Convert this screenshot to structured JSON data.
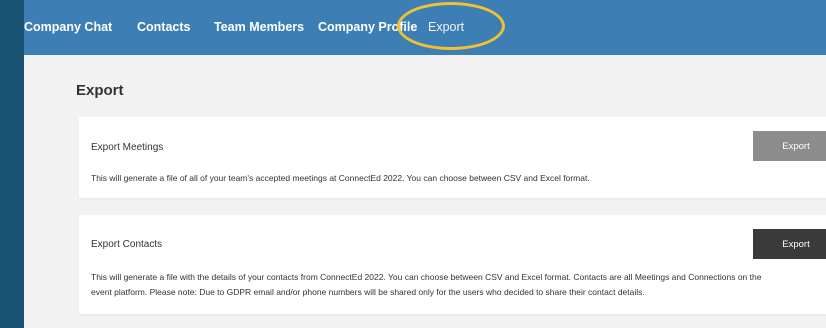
{
  "nav": {
    "items": [
      {
        "label": "Company Chat"
      },
      {
        "label": "Contacts"
      },
      {
        "label": "Team Members"
      },
      {
        "label": "Company Profile"
      },
      {
        "label": "Export"
      }
    ],
    "active": "Export",
    "highlight_color": "#f0c132",
    "bar_color": "#3d7fb5"
  },
  "page": {
    "title": "Export"
  },
  "cards": [
    {
      "title": "Export Meetings",
      "description": "This will generate a file of all of your team's accepted meetings at ConnectEd 2022. You can choose between CSV and Excel format.",
      "button_label": "Export",
      "button_color": "#8c8c8c"
    },
    {
      "title": "Export Contacts",
      "description_line1": "This will generate a file with the details of your contacts from ConnectEd 2022. You can choose between CSV and Excel format. Contacts are all Meetings and Connections on the",
      "description_line2": "event platform. Please note: Due to GDPR email and/or phone numbers will be shared only for the users who decided to share their contact details.",
      "button_label": "Export",
      "button_color": "#3a3a3a"
    }
  ]
}
